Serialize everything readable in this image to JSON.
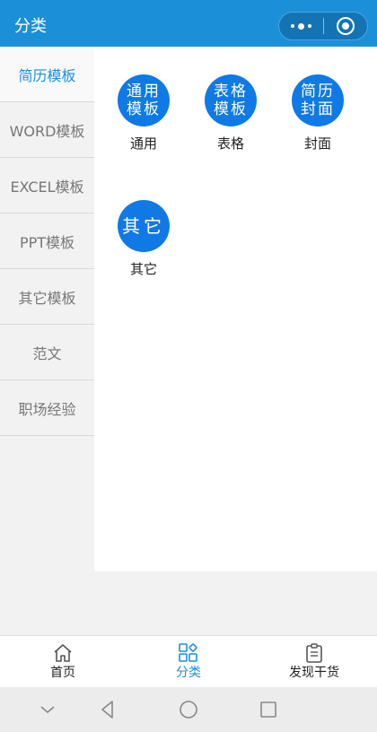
{
  "header": {
    "title": "分类"
  },
  "sidebar": {
    "items": [
      {
        "label": "简历模板",
        "active": true
      },
      {
        "label": "WORD模板",
        "active": false
      },
      {
        "label": "EXCEL模板",
        "active": false
      },
      {
        "label": "PPT模板",
        "active": false
      },
      {
        "label": "其它模板",
        "active": false
      },
      {
        "label": "范文",
        "active": false
      },
      {
        "label": "职场经验",
        "active": false
      }
    ]
  },
  "categories": [
    {
      "badge": "通用\n模板",
      "label": "通用"
    },
    {
      "badge": "表格\n模板",
      "label": "表格"
    },
    {
      "badge": "简历\n封面",
      "label": "封面"
    },
    {
      "badge": "其它",
      "label": "其它"
    }
  ],
  "tabbar": {
    "tabs": [
      {
        "label": "首页",
        "icon": "home-icon"
      },
      {
        "label": "分类",
        "icon": "grid-icon",
        "active": true
      },
      {
        "label": "发现干货",
        "icon": "clipboard-icon"
      }
    ]
  },
  "colors": {
    "accent": "#1c8fd9",
    "badge": "#0f7ae5"
  }
}
